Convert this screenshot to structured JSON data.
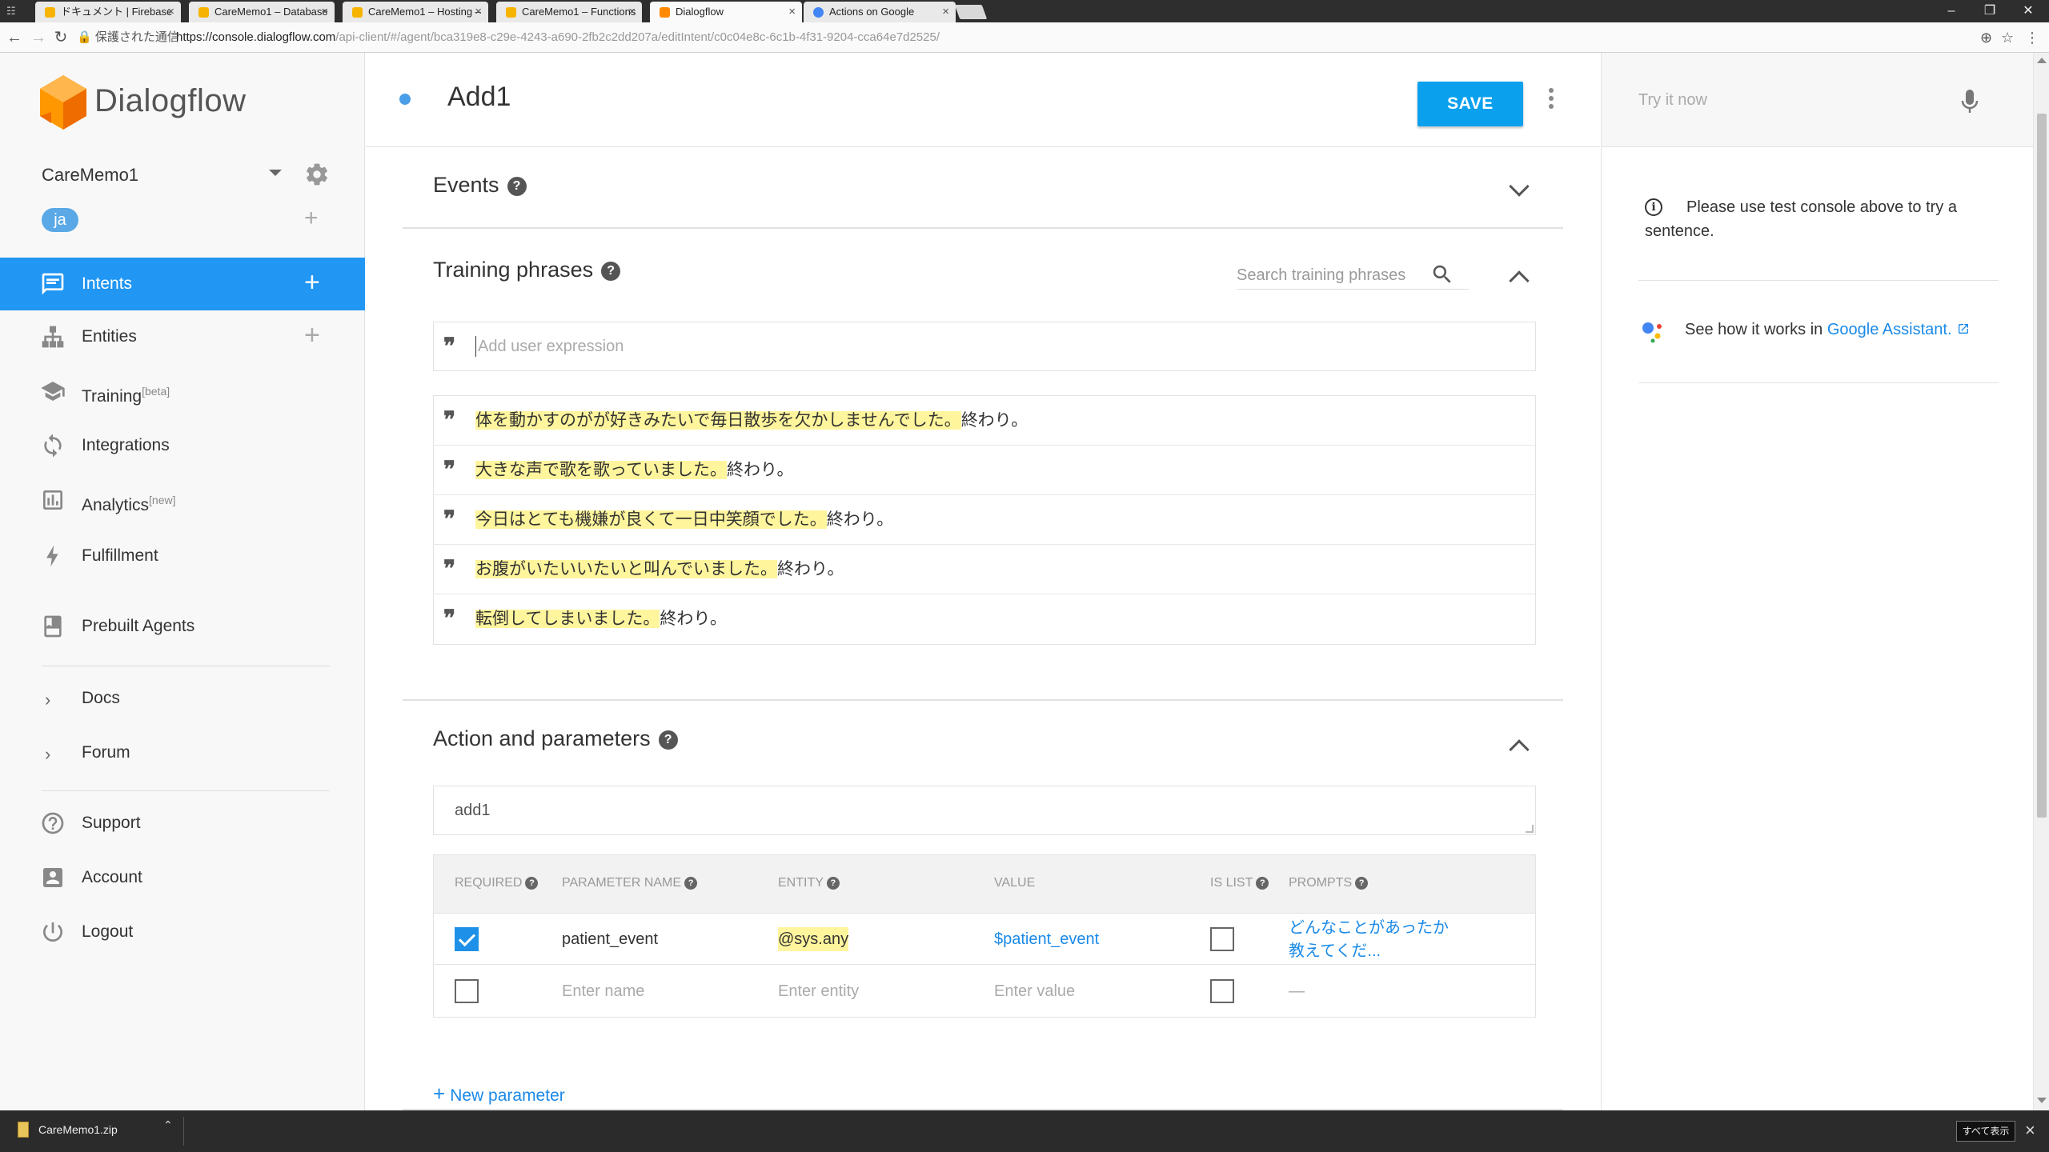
{
  "browser": {
    "tabs": [
      {
        "title": "ドキュメント | Firebase",
        "favicon": "firebase-icon"
      },
      {
        "title": "CareMemo1 – Database",
        "favicon": "firebase-icon"
      },
      {
        "title": "CareMemo1 – Hosting –",
        "favicon": "firebase-icon"
      },
      {
        "title": "CareMemo1 – Functions",
        "favicon": "firebase-icon"
      },
      {
        "title": "Dialogflow",
        "favicon": "dialogflow-icon"
      },
      {
        "title": "Actions on Google",
        "favicon": "actions-on-google-icon"
      }
    ],
    "active_tab": "Dialogflow",
    "secure_label": "保護された通信",
    "url_host": "https://console.dialogflow.com",
    "url_path": "/api-client/#/agent/bca319e8-c29e-4243-a690-2fb2c2dd207a/editIntent/c0c04e8c-6c1b-4f31-9204-cca64e7d2525/"
  },
  "sidebar": {
    "brand": "Dialogflow",
    "agent_name": "CareMemo1",
    "language_chip": "ja",
    "accent_color": "#2196f3",
    "nav": [
      {
        "label": "Intents",
        "icon": "chat-bubble-icon",
        "active": true,
        "has_add": true
      },
      {
        "label": "Entities",
        "icon": "hierarchy-icon",
        "has_add": true
      },
      {
        "label": "Training",
        "sup": "[beta]",
        "icon": "graduation-cap-icon"
      },
      {
        "label": "Integrations",
        "icon": "sync-icon"
      },
      {
        "label": "Analytics",
        "sup": "[new]",
        "icon": "bar-chart-icon"
      },
      {
        "label": "Fulfillment",
        "icon": "lightning-icon"
      },
      {
        "label": "Prebuilt Agents",
        "icon": "book-icon"
      },
      {
        "label": "Docs",
        "icon": "chevron-right-icon"
      },
      {
        "label": "Forum",
        "icon": "chevron-right-icon"
      },
      {
        "label": "Support",
        "icon": "help-circle-icon"
      },
      {
        "label": "Account",
        "icon": "account-box-icon"
      },
      {
        "label": "Logout",
        "icon": "power-icon"
      }
    ]
  },
  "main": {
    "intent_name": "Add1",
    "save_label": "SAVE",
    "events_title": "Events",
    "training_title": "Training phrases",
    "search_placeholder": "Search training phrases",
    "expression_placeholder": "Add user expression",
    "phrases": [
      {
        "highlight": "体を動かすのがが好きみたいで毎日散歩を欠かしませんでした。",
        "rest": "終わり。"
      },
      {
        "highlight": "大きな声で歌を歌っていました。",
        "rest": "終わり。"
      },
      {
        "highlight": "今日はとても機嫌が良くて一日中笑顔でした。",
        "rest": "終わり。"
      },
      {
        "highlight": "お腹がいたいいたいと叫んでいました。",
        "rest": "終わり。"
      },
      {
        "highlight": "転倒してしまいました。",
        "rest": "終わり。"
      }
    ],
    "action_title": "Action and parameters",
    "action_value": "add1",
    "param_headers": {
      "required": "REQUIRED",
      "name": "PARAMETER NAME",
      "entity": "ENTITY",
      "value": "VALUE",
      "is_list": "IS LIST",
      "prompts": "PROMPTS"
    },
    "params": [
      {
        "required": true,
        "name": "patient_event",
        "entity": "@sys.any",
        "value": "$patient_event",
        "is_list": false,
        "prompt_line1": "どんなことがあったか",
        "prompt_line2": "教えてくだ..."
      }
    ],
    "new_row": {
      "name_placeholder": "Enter name",
      "entity_placeholder": "Enter entity",
      "value_placeholder": "Enter value",
      "prompt": "—"
    },
    "new_param_label": "New parameter"
  },
  "test_panel": {
    "try_placeholder": "Try it now",
    "info_text": "Please use test console above to try a sentence.",
    "ga_prefix": "See how it works in ",
    "ga_link": "Google Assistant."
  },
  "download_bar": {
    "file": "CareMemo1.zip",
    "show_all": "すべて表示"
  }
}
